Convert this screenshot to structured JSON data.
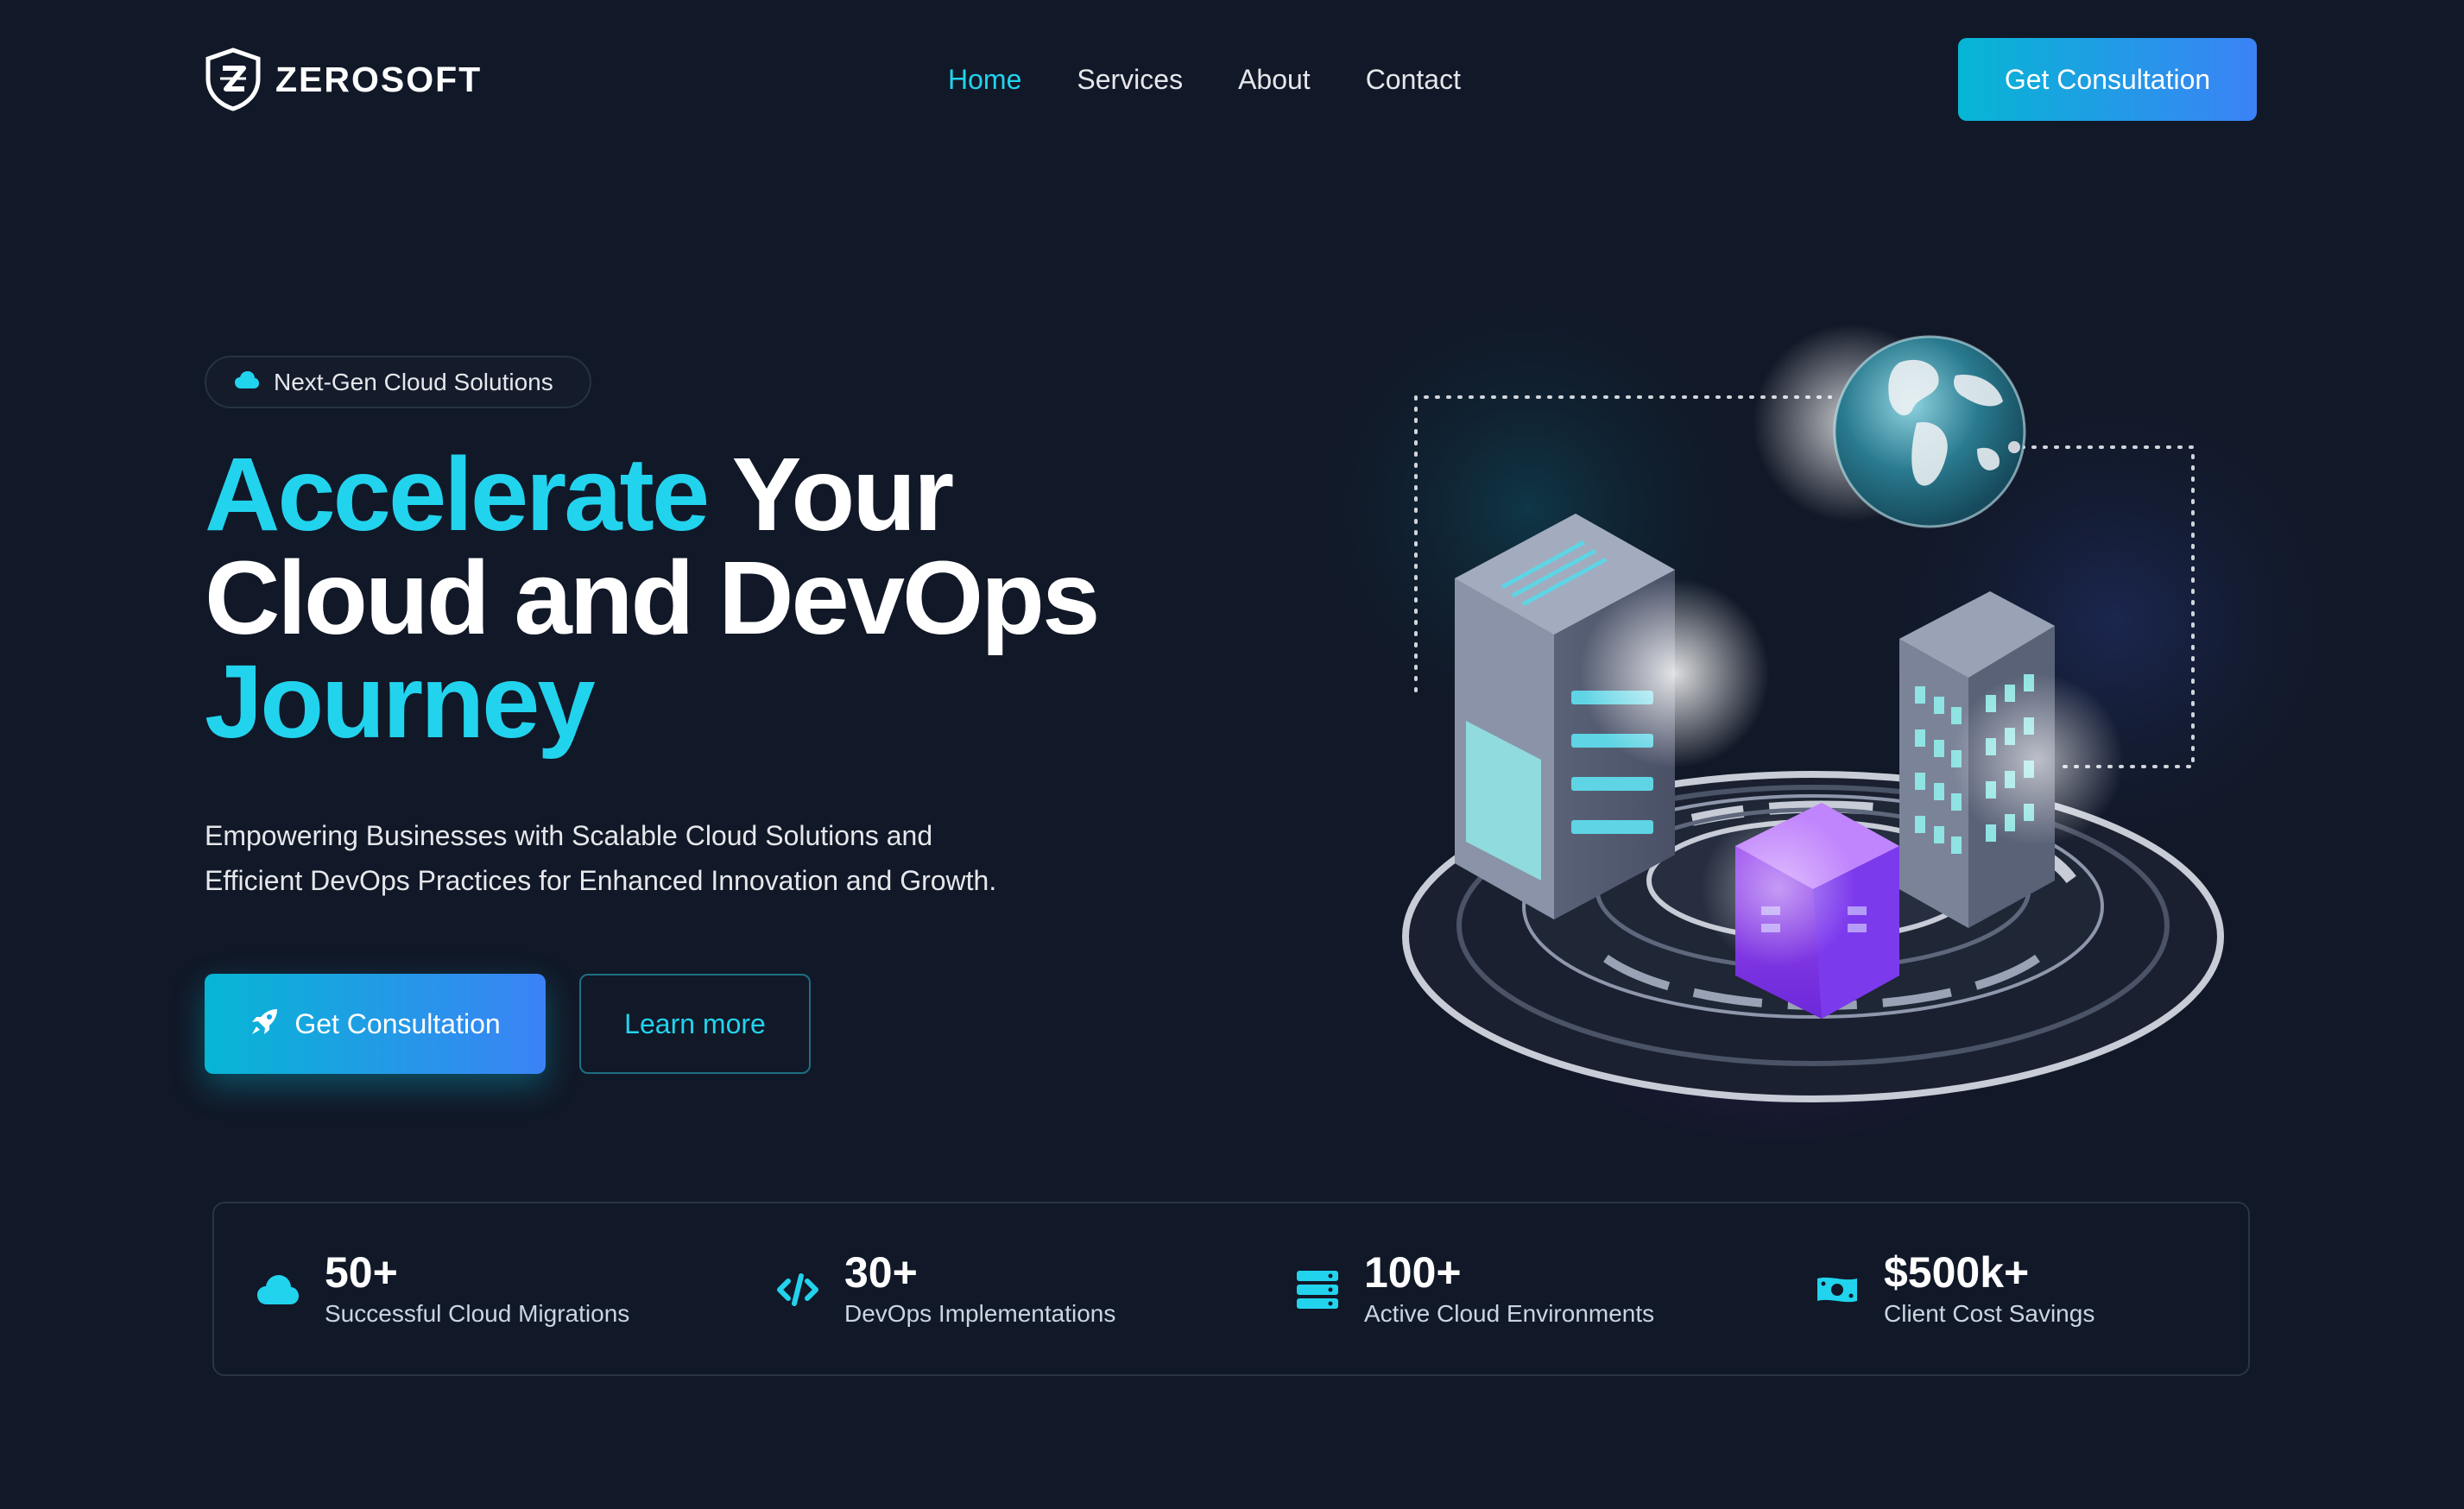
{
  "brand": {
    "name": "ZEROSOFT",
    "logo_icon": "shield-z-logo"
  },
  "nav": {
    "items": [
      {
        "label": "Home",
        "active": true
      },
      {
        "label": "Services",
        "active": false
      },
      {
        "label": "About",
        "active": false
      },
      {
        "label": "Contact",
        "active": false
      }
    ],
    "cta_label": "Get Consultation"
  },
  "hero": {
    "badge": {
      "icon": "cloud-icon",
      "text": "Next-Gen Cloud Solutions"
    },
    "headline": {
      "line1_accent": "Accelerate",
      "line1_rest": " Your",
      "line2": "Cloud and DevOps",
      "line3_accent": "Journey"
    },
    "subtitle_line1": "Empowering Businesses with Scalable Cloud Solutions and",
    "subtitle_line2": "Efficient DevOps Practices for Enhanced Innovation and Growth.",
    "primary_button": {
      "icon": "rocket-icon",
      "label": "Get Consultation"
    },
    "secondary_button": {
      "label": "Learn more"
    }
  },
  "stats": [
    {
      "icon": "cloud-icon",
      "value": "50+",
      "label": "Successful Cloud Migrations"
    },
    {
      "icon": "code-icon",
      "value": "30+",
      "label": "DevOps Implementations"
    },
    {
      "icon": "server-icon",
      "value": "100+",
      "label": "Active Cloud Environments"
    },
    {
      "icon": "money-icon",
      "value": "$500k+",
      "label": "Client Cost Savings"
    }
  ],
  "colors": {
    "background": "#111827",
    "accent": "#22d3ee",
    "gradient_start": "#06b6d4",
    "gradient_end": "#3b82f6",
    "text_muted": "#cbd5e1"
  }
}
